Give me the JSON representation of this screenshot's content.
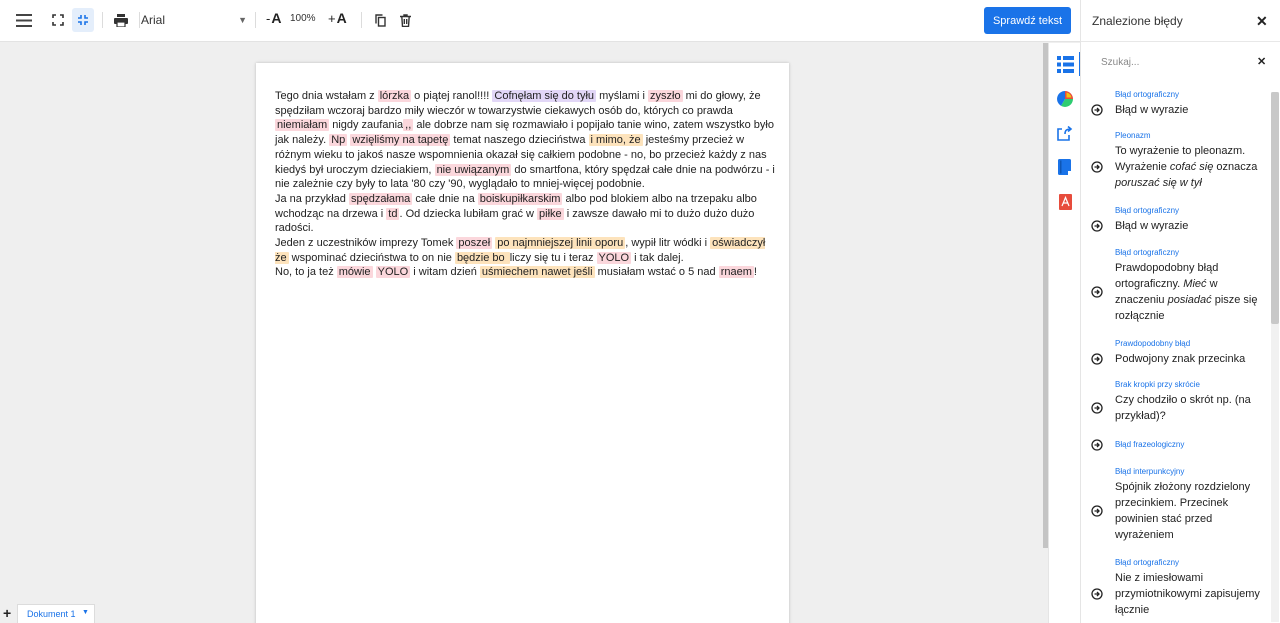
{
  "toolbar": {
    "font_name": "Arial",
    "zoom_level": "100%",
    "font_smaller_prefix": "-",
    "font_larger_prefix": "+",
    "font_letter": "A",
    "check_button_label": "Sprawdź tekst",
    "icons": [
      "menu-icon",
      "fullscreen-icon",
      "exit-fullscreen-icon",
      "print-icon",
      "copy-icon",
      "trash-icon"
    ]
  },
  "document": {
    "paragraphs": [
      [
        {
          "t": "Tego dnia wstałam z "
        },
        {
          "t": "lórzka",
          "h": "red"
        },
        {
          "t": " o piątej ranol!!!! "
        },
        {
          "t": "Cofnęłam się do tyłu",
          "h": "purple"
        },
        {
          "t": " myślami i "
        },
        {
          "t": "zyszło",
          "h": "red"
        },
        {
          "t": " mi do głowy, że spędziłam wczoraj bardzo miły wieczór w towarzystwie ciekawych osób do, których co prawda "
        },
        {
          "t": "niemiałam",
          "h": "red"
        },
        {
          "t": " nigdy zaufania"
        },
        {
          "t": ",,",
          "h": "red"
        },
        {
          "t": " ale dobrze nam się rozmawiało i popijało tanie wino, zatem wszystko było jak należy. "
        },
        {
          "t": "Np",
          "h": "red"
        },
        {
          "t": " "
        },
        {
          "t": "wzięliśmy na tapetę",
          "h": "red"
        },
        {
          "t": " temat naszego dzieciństwa "
        },
        {
          "t": "i mimo, że",
          "h": "orange"
        },
        {
          "t": " jesteśmy przecież w różnym wieku to jakoś nasze wspomnienia okazał się całkiem podobne - no, bo przecież każdy z nas kiedyś był uroczym dzieciakiem, "
        },
        {
          "t": "nie uwiązanym",
          "h": "red"
        },
        {
          "t": " do smartfona, który spędzał całe dnie na podwórzu - i nie zależnie czy były to lata '80 czy '90, wyglądało to mniej-więcej podobnie."
        }
      ],
      [
        {
          "t": "Ja na przykład "
        },
        {
          "t": "spędzałama",
          "h": "red"
        },
        {
          "t": " całe dnie na "
        },
        {
          "t": "boiskupiłkarskim",
          "h": "red"
        },
        {
          "t": " albo pod blokiem albo na trzepaku albo wchodząc na drzewa i "
        },
        {
          "t": "td",
          "h": "red"
        },
        {
          "t": ". Od dziecka lubiłam grać w "
        },
        {
          "t": "piłke",
          "h": "red"
        },
        {
          "t": " i zawsze dawało mi to dużo dużo dużo radości."
        }
      ],
      [
        {
          "t": "Jeden z uczestników imprezy Tomek "
        },
        {
          "t": "poszeł",
          "h": "red"
        },
        {
          "t": " "
        },
        {
          "t": "po najmniejszej linii oporu",
          "h": "orange"
        },
        {
          "t": ", wypił litr wódki i "
        },
        {
          "t": "oświadczył że",
          "h": "orange"
        },
        {
          "t": " wspominać dzieciństwa to on nie "
        },
        {
          "t": "będzie bo ",
          "h": "orange"
        },
        {
          "t": " liczy się tu i teraz "
        },
        {
          "t": "YOLO",
          "h": "red"
        },
        {
          "t": " i tak dalej."
        }
      ],
      [
        {
          "t": "No, to ja też "
        },
        {
          "t": "mówie",
          "h": "red"
        },
        {
          "t": " "
        },
        {
          "t": "YOLO",
          "h": "red"
        },
        {
          "t": " i witam dzień "
        },
        {
          "t": "uśmiechem nawet jeśli",
          "h": "orange"
        },
        {
          "t": " musiałam wstać o 5 nad "
        },
        {
          "t": "rnaem",
          "h": "red"
        },
        {
          "t": "!"
        }
      ]
    ]
  },
  "rail": {
    "icons": [
      "error-list-icon",
      "statistics-icon",
      "export-icon",
      "dictionary-icon",
      "pdf-icon"
    ]
  },
  "panel": {
    "title": "Znalezione błędy",
    "search_placeholder": "Szukaj...",
    "errors": [
      {
        "category": "Błąd ortograficzny",
        "description": [
          {
            "t": "Błąd w wyrazie"
          }
        ]
      },
      {
        "category": "Pleonazm",
        "description": [
          {
            "t": "To wyrażenie to pleonazm. Wyrażenie "
          },
          {
            "t": "cofać się",
            "i": true
          },
          {
            "t": " oznacza "
          },
          {
            "t": "poruszać się w tył",
            "i": true
          }
        ]
      },
      {
        "category": "Błąd ortograficzny",
        "description": [
          {
            "t": "Błąd w wyrazie"
          }
        ]
      },
      {
        "category": "Błąd ortograficzny",
        "description": [
          {
            "t": "Prawdopodobny błąd ortograficzny. "
          },
          {
            "t": "Mieć",
            "i": true
          },
          {
            "t": " w znaczeniu "
          },
          {
            "t": "posiadać",
            "i": true
          },
          {
            "t": " pisze się rozłącznie"
          }
        ]
      },
      {
        "category": "Prawdopodobny błąd",
        "description": [
          {
            "t": "Podwojony znak przecinka"
          }
        ]
      },
      {
        "category": "Brak kropki przy skrócie",
        "description": [
          {
            "t": "Czy chodziło o skrót np. (na przykład)?"
          }
        ]
      },
      {
        "category": "Błąd frazeologiczny",
        "description": []
      },
      {
        "category": "Błąd interpunkcyjny",
        "description": [
          {
            "t": "Spójnik złożony rozdzielony przecinkiem. Przecinek powinien stać przed wyrażeniem"
          }
        ]
      },
      {
        "category": "Błąd ortograficzny",
        "description": [
          {
            "t": "Nie z imiesłowami przymiotnikowymi zapisujemy łącznie"
          }
        ]
      }
    ]
  },
  "bottom": {
    "add_label": "+",
    "tab_label": "Dokument 1"
  },
  "colors": {
    "accent": "#1a73e8",
    "highlight_spelling": "#fbd7dc",
    "highlight_style": "#fde3bc",
    "highlight_pleonasm": "#e2d7f7"
  }
}
